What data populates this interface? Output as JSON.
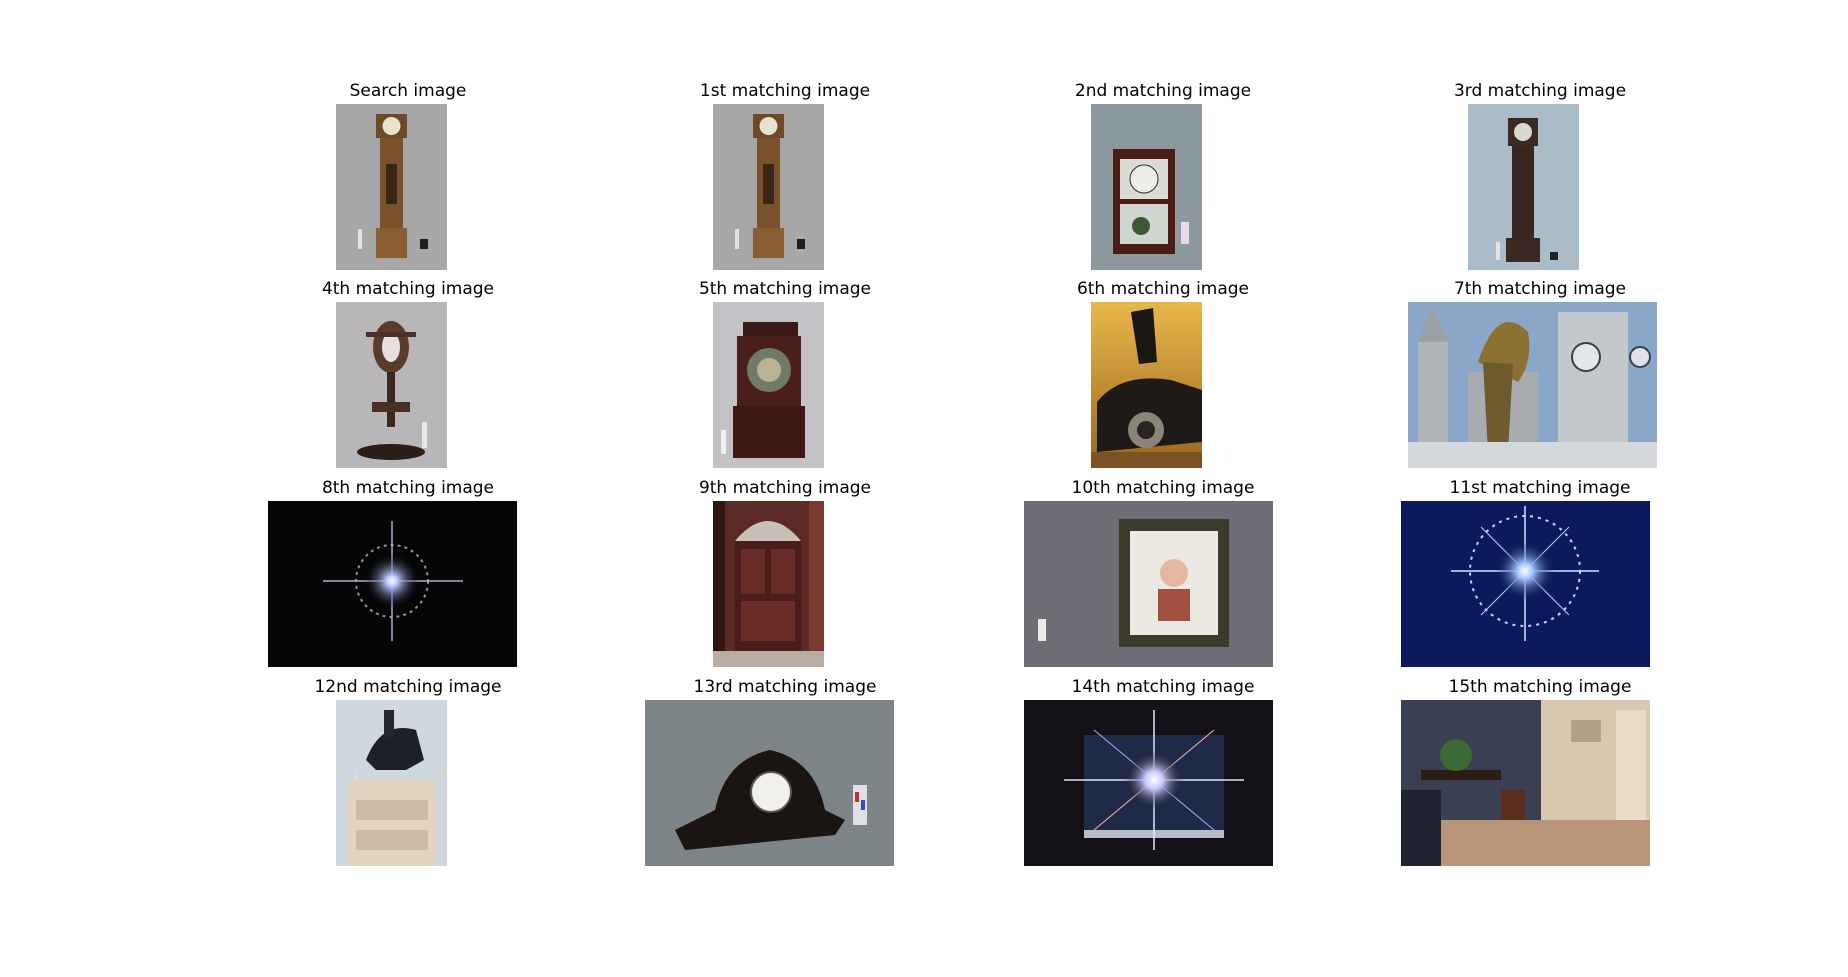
{
  "figure": {
    "cells": [
      {
        "title": "Search image",
        "icon": "grandfather-clock-icon",
        "orientation": "portrait",
        "background": "#a7a7a7"
      },
      {
        "title": "1st matching image",
        "icon": "grandfather-clock-icon",
        "orientation": "portrait",
        "background": "#a7a7a7"
      },
      {
        "title": "2nd matching image",
        "icon": "shelf-clock-icon",
        "orientation": "portrait",
        "background": "#8c9aa0"
      },
      {
        "title": "3rd matching image",
        "icon": "grandfather-clock-icon",
        "orientation": "portrait",
        "background": "#a9bcc7"
      },
      {
        "title": "4th matching image",
        "icon": "ornate-clock-stand-icon",
        "orientation": "portrait",
        "background": "#b9b6ba"
      },
      {
        "title": "5th matching image",
        "icon": "cabinet-clock-icon",
        "orientation": "portrait",
        "background": "#c4c2c6"
      },
      {
        "title": "6th matching image",
        "icon": "sports-car-icon",
        "orientation": "portrait",
        "background": "#d29a36"
      },
      {
        "title": "7th matching image",
        "icon": "statue-clock-tower-icon",
        "orientation": "landscape",
        "background": "#8aa6c8"
      },
      {
        "title": "8th matching image",
        "icon": "starburst-icon",
        "orientation": "landscape",
        "background": "#050505"
      },
      {
        "title": "9th matching image",
        "icon": "wooden-door-icon",
        "orientation": "portrait",
        "background": "#5a2a26"
      },
      {
        "title": "10th matching image",
        "icon": "picture-frame-icon",
        "orientation": "landscape",
        "background": "#6e6c74"
      },
      {
        "title": "11st matching image",
        "icon": "starburst-icon",
        "orientation": "landscape",
        "background": "#0a1a5c"
      },
      {
        "title": "12nd matching image",
        "icon": "equestrian-statue-icon",
        "orientation": "portrait",
        "background": "#cfd8de"
      },
      {
        "title": "13rd matching image",
        "icon": "mantel-clock-icon",
        "orientation": "landscape",
        "background": "#7d8487"
      },
      {
        "title": "14th matching image",
        "icon": "starburst-icon",
        "orientation": "landscape",
        "background": "#141018"
      },
      {
        "title": "15th matching image",
        "icon": "office-room-icon",
        "orientation": "landscape",
        "background": "#3a3f52"
      }
    ]
  }
}
